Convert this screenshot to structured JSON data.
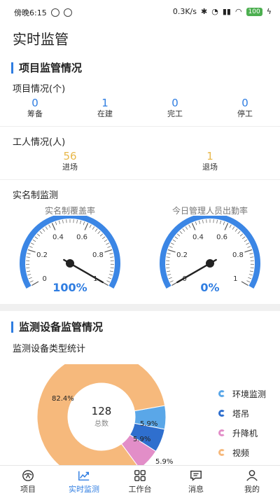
{
  "status_bar": {
    "time": "傍晚6:15",
    "speed": "0.3K/s",
    "battery": "100"
  },
  "page_title": "实时监管",
  "project_section": {
    "header": "项目监管情况",
    "project_label": "项目情况(个)",
    "project_stats": [
      {
        "value": "0",
        "label": "筹备"
      },
      {
        "value": "1",
        "label": "在建"
      },
      {
        "value": "0",
        "label": "完工"
      },
      {
        "value": "0",
        "label": "停工"
      }
    ],
    "worker_label": "工人情况(人)",
    "worker_stats": [
      {
        "value": "56",
        "label": "进场"
      },
      {
        "value": "1",
        "label": "退场"
      }
    ],
    "realname_label": "实名制监测",
    "gauges": [
      {
        "title": "实名制覆盖率",
        "value_text": "100%",
        "value": 1.0,
        "ticks": [
          "0",
          "0.2",
          "0.4",
          "0.6",
          "0.8",
          "1"
        ]
      },
      {
        "title": "今日管理人员出勤率",
        "value_text": "0%",
        "value": 0.0,
        "ticks": [
          "0",
          "0.2",
          "0.4",
          "0.6",
          "0.8",
          "1"
        ]
      }
    ]
  },
  "device_section": {
    "header": "监测设备监管情况",
    "type_label": "监测设备类型统计",
    "total_value": "128",
    "total_label": "总数",
    "colors": {
      "env": "#5aa7e8",
      "tower": "#2f6fce",
      "lift": "#e28ec8",
      "video": "#f6b97c"
    }
  },
  "chart_data": {
    "type": "pie",
    "categories": [
      "环境监测",
      "塔吊",
      "升降机",
      "视频"
    ],
    "values": [
      5.9,
      5.9,
      5.9,
      82.4
    ],
    "labels": [
      "5.9%",
      "5.9%",
      "5.9%",
      "82.4%"
    ],
    "center_text": "128",
    "center_subtext": "总数",
    "legend_position": "right"
  },
  "bottom_nav": [
    {
      "label": "项目",
      "icon": "project-icon",
      "active": false
    },
    {
      "label": "实时监测",
      "icon": "chart-trend-icon",
      "active": true
    },
    {
      "label": "工作台",
      "icon": "grid-icon",
      "active": false
    },
    {
      "label": "消息",
      "icon": "message-icon",
      "active": false
    },
    {
      "label": "我的",
      "icon": "user-icon",
      "active": false
    }
  ]
}
